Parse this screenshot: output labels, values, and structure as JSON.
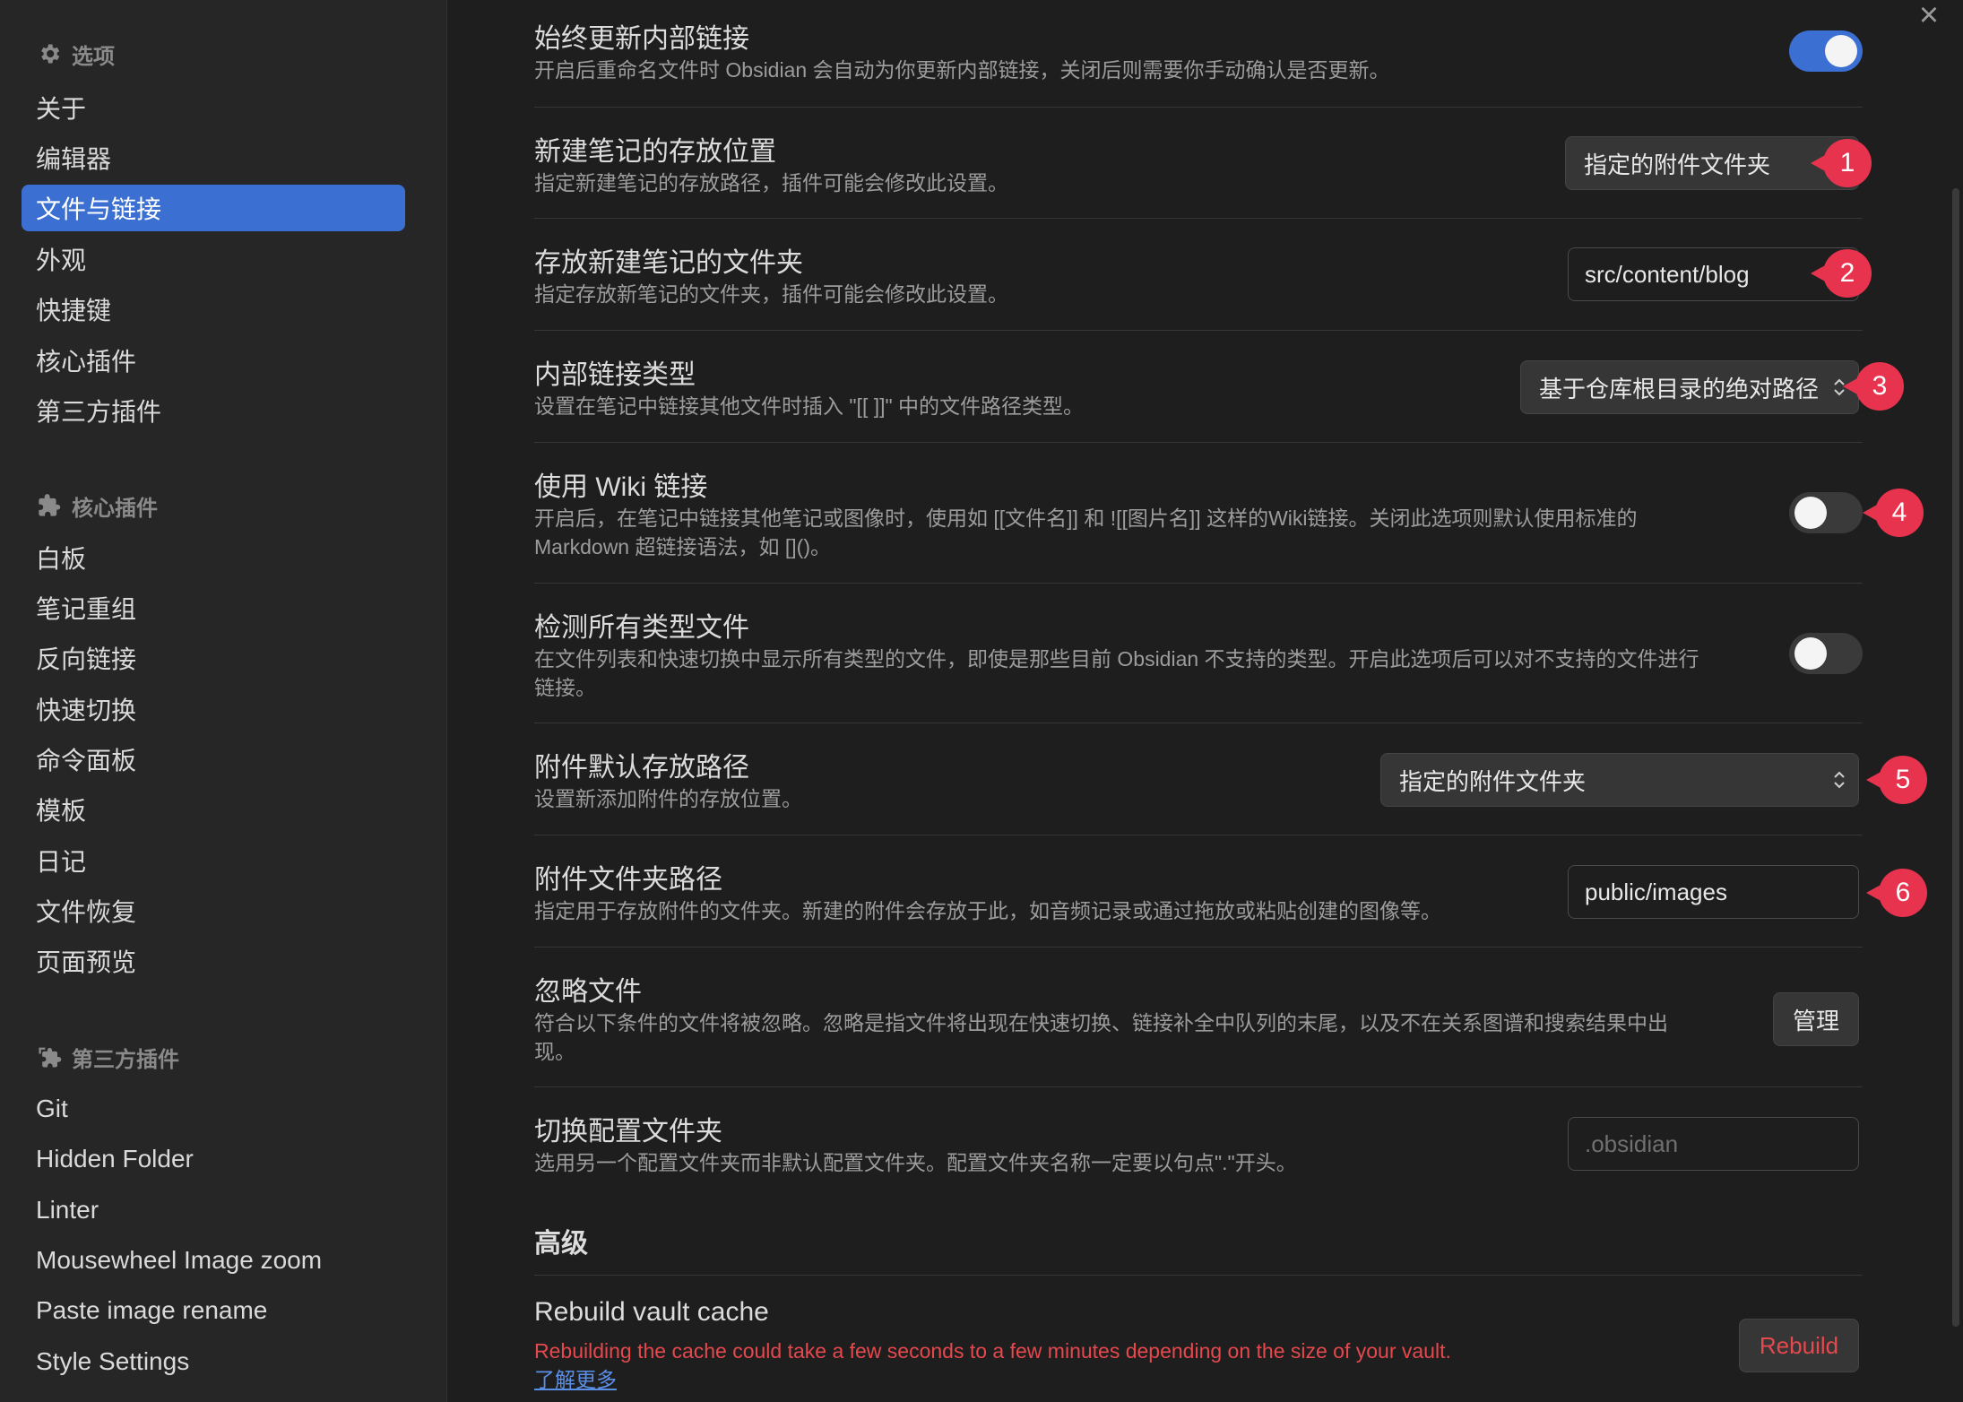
{
  "sidebar": {
    "options_title": "选项",
    "options_items": [
      "关于",
      "编辑器",
      "文件与链接",
      "外观",
      "快捷键",
      "核心插件",
      "第三方插件"
    ],
    "core_title": "核心插件",
    "core_items": [
      "白板",
      "笔记重组",
      "反向链接",
      "快速切换",
      "命令面板",
      "模板",
      "日记",
      "文件恢复",
      "页面预览"
    ],
    "third_title": "第三方插件",
    "third_items": [
      "Git",
      "Hidden Folder",
      "Linter",
      "Mousewheel Image zoom",
      "Paste image rename",
      "Style Settings"
    ]
  },
  "settings": {
    "always_update": {
      "title": "始终更新内部链接",
      "desc": "开启后重命名文件时 Obsidian 会自动为你更新内部链接，关闭后则需要你手动确认是否更新。",
      "enabled": true
    },
    "new_note_location": {
      "title": "新建笔记的存放位置",
      "desc": "指定新建笔记的存放路径，插件可能会修改此设置。",
      "value": "指定的附件文件夹"
    },
    "new_note_folder": {
      "title": "存放新建笔记的文件夹",
      "desc": "指定存放新笔记的文件夹，插件可能会修改此设置。",
      "value": "src/content/blog"
    },
    "link_type": {
      "title": "内部链接类型",
      "desc": "设置在笔记中链接其他文件时插入 \"[[ ]]\" 中的文件路径类型。",
      "value": "基于仓库根目录的绝对路径"
    },
    "wiki_links": {
      "title": "使用 Wiki 链接",
      "desc_line1": "开启后，在笔记中链接其他笔记或图像时，使用如 [[文件名]] 和 ![[图片名]] 这样的Wiki链接。关闭此选项则默认使用标准的",
      "desc_line2": "Markdown 超链接语法，如 []()。",
      "enabled": false
    },
    "detect_all": {
      "title": "检测所有类型文件",
      "desc_line1": "在文件列表和快速切换中显示所有类型的文件，即使是那些目前 Obsidian 不支持的类型。开启此选项后可以对不支持的文件进行",
      "desc_line2": "链接。",
      "enabled": false
    },
    "attachment_location": {
      "title": "附件默认存放路径",
      "desc": "设置新添加附件的存放位置。",
      "value": "指定的附件文件夹"
    },
    "attachment_folder": {
      "title": "附件文件夹路径",
      "desc": "指定用于存放附件的文件夹。新建的附件会存放于此，如音频记录或通过拖放或粘贴创建的图像等。",
      "value": "public/images"
    },
    "ignore_files": {
      "title": "忽略文件",
      "desc_line1": "符合以下条件的文件将被忽略。忽略是指文件将出现在快速切换、链接补全中队列的末尾，以及不在关系图谱和搜索结果中出",
      "desc_line2": "现。",
      "button": "管理"
    },
    "config_folder": {
      "title": "切换配置文件夹",
      "desc": "选用另一个配置文件夹而非默认配置文件夹。配置文件夹名称一定要以句点\".\"开头。",
      "placeholder": ".obsidian"
    },
    "advanced_title": "高级",
    "rebuild": {
      "title": "Rebuild vault cache",
      "desc": "Rebuilding the cache could take a few seconds to a few minutes depending on the size of your vault.",
      "link": "了解更多",
      "button": "Rebuild"
    }
  },
  "badges": [
    "1",
    "2",
    "3",
    "4",
    "5",
    "6"
  ],
  "icons": {
    "close": "close-icon",
    "gear": "gear-icon",
    "puzzle": "puzzle-icon",
    "plugins": "plugins-icon",
    "chevron": "chevron-updown-icon"
  },
  "colors": {
    "accent": "#3b6fd1",
    "badge": "#e8334f",
    "danger": "#e5484d"
  }
}
